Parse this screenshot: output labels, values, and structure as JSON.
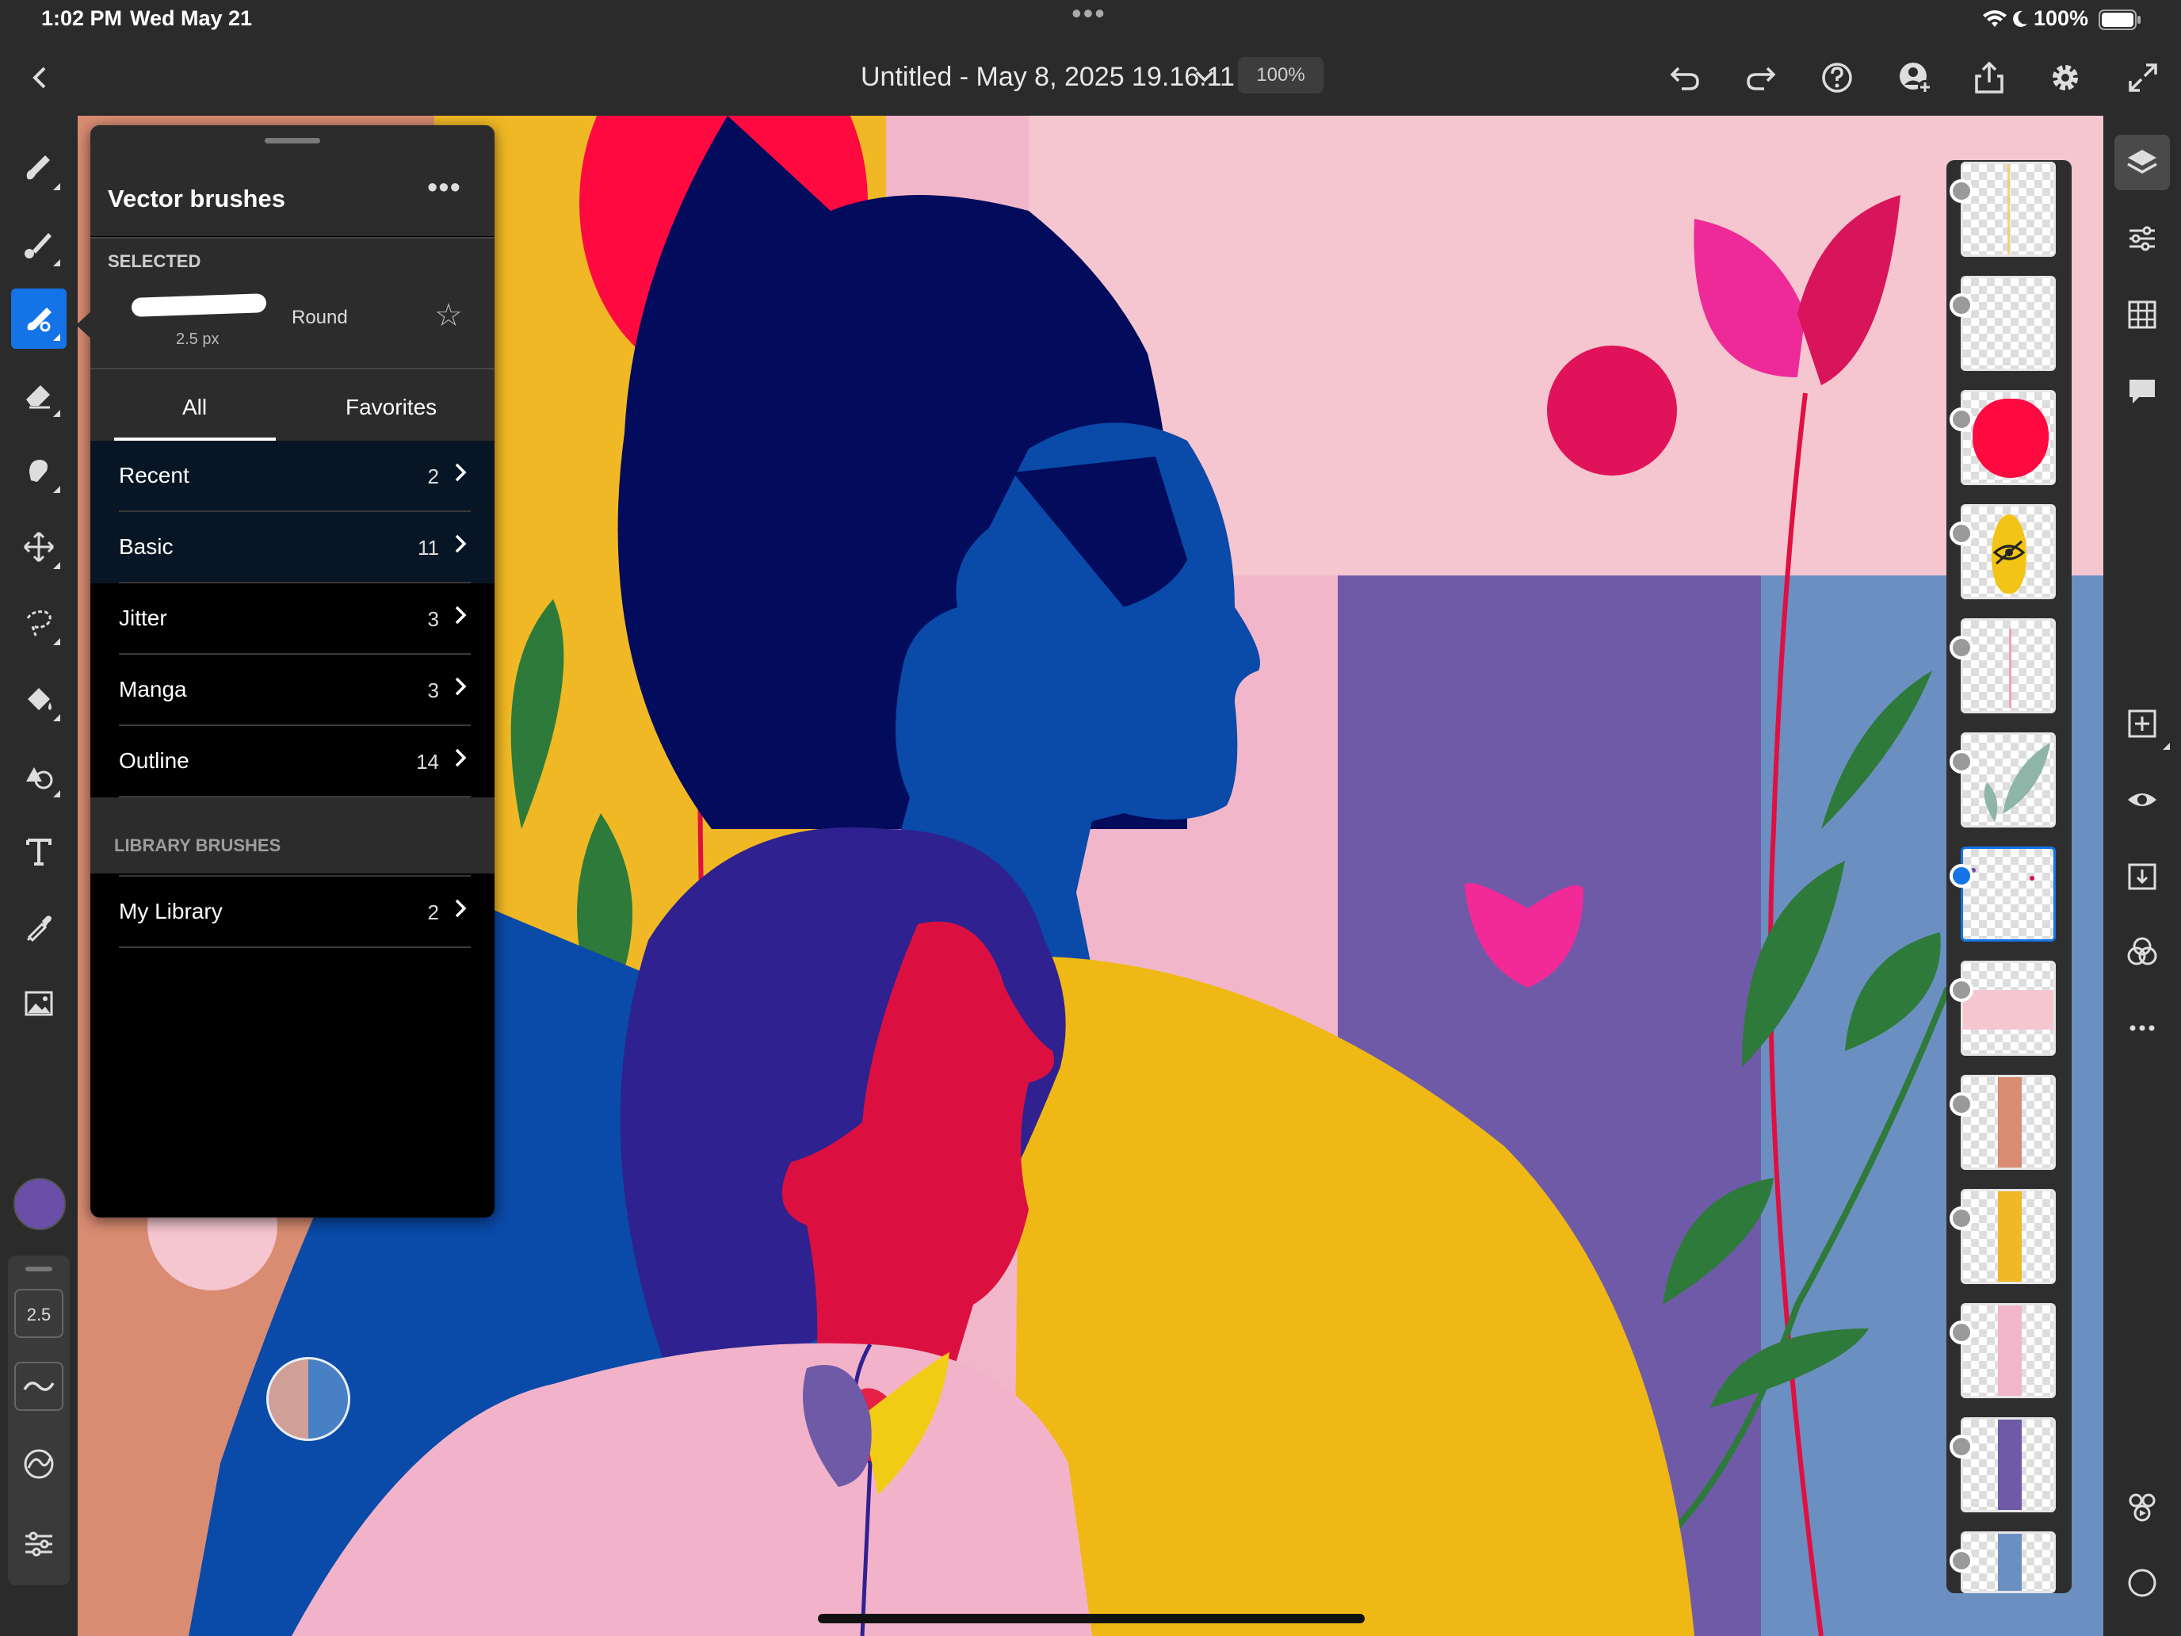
{
  "status_bar": {
    "time": "1:02 PM",
    "date": "Wed May 21",
    "battery": "100%"
  },
  "app_bar": {
    "doc_title": "Untitled - May 8, 2025 19.16.11",
    "zoom": "100%"
  },
  "left_toolbar": {
    "brush_size": "2.5",
    "color_swatch": "#6b4ea8"
  },
  "brush_panel": {
    "title": "Vector brushes",
    "selected_label": "SELECTED",
    "selected_brush": {
      "name": "Round",
      "size": "2.5 px"
    },
    "tabs": [
      "All",
      "Favorites"
    ],
    "categories": [
      {
        "label": "Recent",
        "count": "2"
      },
      {
        "label": "Basic",
        "count": "11"
      },
      {
        "label": "Jitter",
        "count": "3"
      },
      {
        "label": "Manga",
        "count": "3"
      },
      {
        "label": "Outline",
        "count": "14"
      }
    ],
    "library_heading": "LIBRARY BRUSHES",
    "library": [
      {
        "label": "My Library",
        "count": "2"
      }
    ]
  },
  "colors": {
    "accent": "#1473e6",
    "panel": "#2c2c2c",
    "toolbar": "#2b2b2b"
  }
}
